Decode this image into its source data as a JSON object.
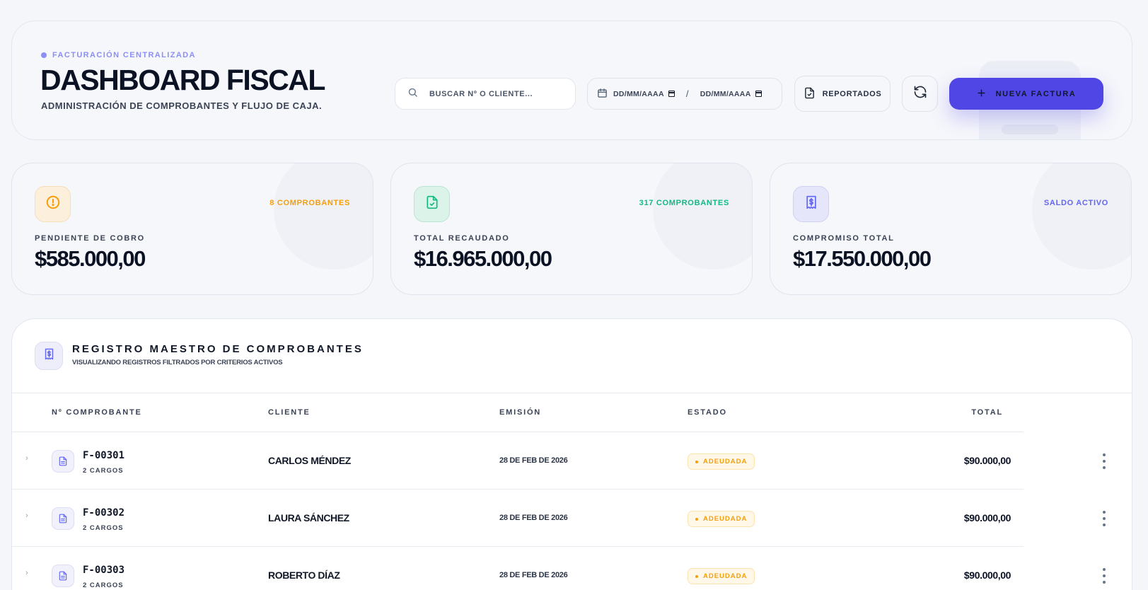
{
  "header": {
    "eyebrow": "FACTURACIÓN CENTRALIZADA",
    "title": "DASHBOARD FISCAL",
    "subtitle": "ADMINISTRACIÓN DE COMPROBANTES Y FLUJO DE CAJA.",
    "search_placeholder": "BUSCAR Nº O CLIENTE...",
    "date_from_placeholder": "DD/MM/AAAA",
    "date_to_placeholder": "DD/MM/AAAA",
    "date_separator": "/",
    "reportados_label": "REPORTADOS",
    "new_invoice_label": "NUEVA FACTURA"
  },
  "stats": [
    {
      "label": "PENDIENTE DE COBRO",
      "value": "$585.000,00",
      "count": "8 COMPROBANTES",
      "icon": "alert-circle-icon",
      "accent": "#f59e0b",
      "icon_bg": "#fcefdc"
    },
    {
      "label": "TOTAL RECAUDADO",
      "value": "$16.965.000,00",
      "count": "317 COMPROBANTES",
      "icon": "file-check-icon",
      "accent": "#10b981",
      "icon_bg": "#dcf3ea"
    },
    {
      "label": "COMPROMISO TOTAL",
      "value": "$17.550.000,00",
      "count": "SALDO ACTIVO",
      "icon": "receipt-dollar-icon",
      "accent": "#6366f1",
      "icon_bg": "#e6e6fb"
    }
  ],
  "table": {
    "title": "REGISTRO MAESTRO DE COMPROBANTES",
    "subtitle": "VISUALIZANDO REGISTROS FILTRADOS POR CRITERIOS ACTIVOS",
    "columns": {
      "number": "Nº COMPROBANTE",
      "client": "CLIENTE",
      "issued": "EMISIÓN",
      "status": "ESTADO",
      "total": "TOTAL"
    },
    "rows": [
      {
        "number": "F-00301",
        "charges": "2 CARGOS",
        "client": "CARLOS MÉNDEZ",
        "issued": "28 DE FEB DE 2026",
        "status": "ADEUDADA",
        "total": "$90.000,00"
      },
      {
        "number": "F-00302",
        "charges": "2 CARGOS",
        "client": "LAURA SÁNCHEZ",
        "issued": "28 DE FEB DE 2026",
        "status": "ADEUDADA",
        "total": "$90.000,00"
      },
      {
        "number": "F-00303",
        "charges": "2 CARGOS",
        "client": "ROBERTO DÍAZ",
        "issued": "28 DE FEB DE 2026",
        "status": "ADEUDADA",
        "total": "$90.000,00"
      }
    ]
  },
  "colors": {
    "primary": "#4f46e5",
    "pending": "#f59e0b",
    "success": "#10b981",
    "indigo": "#6366f1"
  }
}
